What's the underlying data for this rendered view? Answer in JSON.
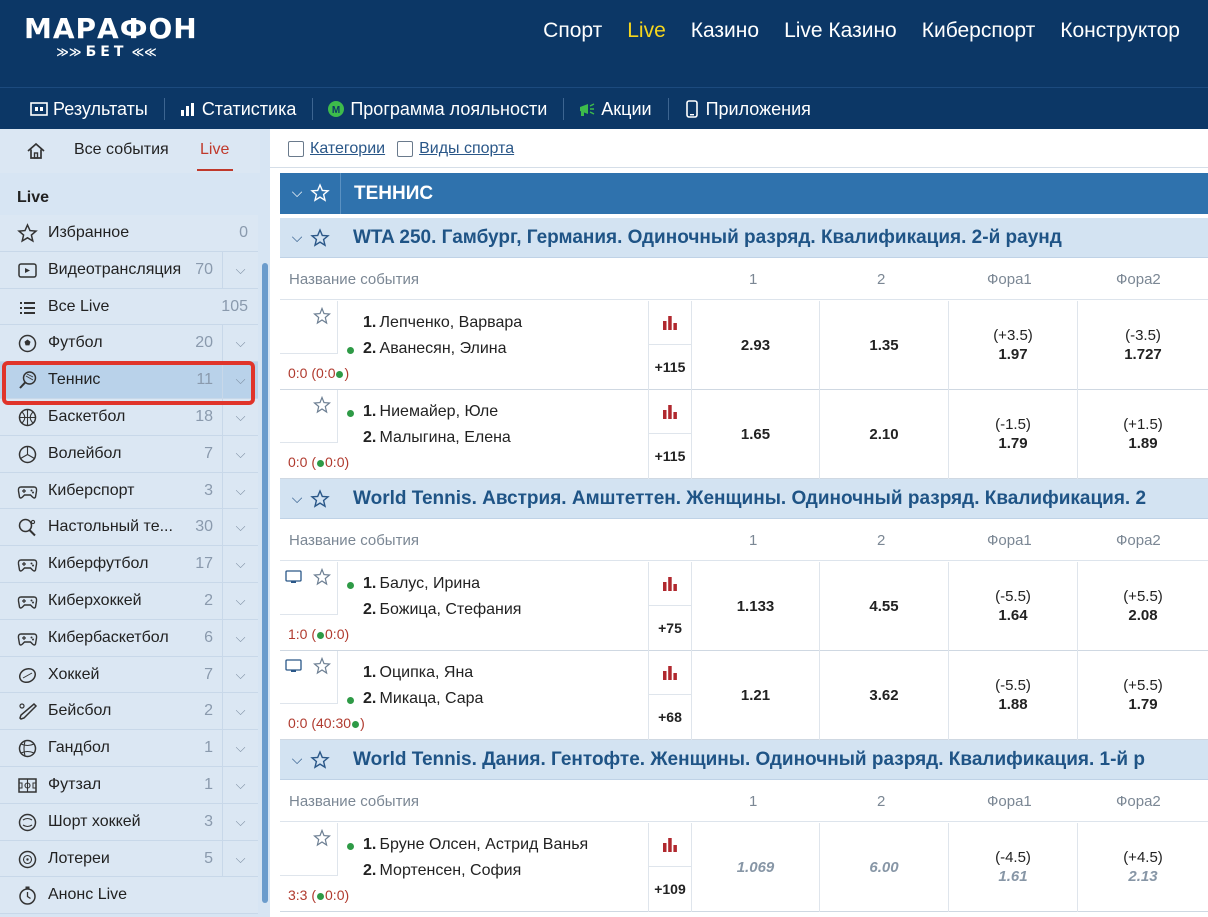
{
  "header": {
    "logo_main": "МАРАФОН",
    "logo_sub": "БЕТ",
    "nav": [
      {
        "label": "Спорт",
        "active": false
      },
      {
        "label": "Live",
        "active": true
      },
      {
        "label": "Казино",
        "active": false
      },
      {
        "label": "Live Казино",
        "active": false
      },
      {
        "label": "Киберспорт",
        "active": false
      },
      {
        "label": "Конструктор",
        "active": false
      }
    ]
  },
  "subnav": [
    {
      "label": "Результаты",
      "icon": "results-icon"
    },
    {
      "label": "Статистика",
      "icon": "statistics-icon"
    },
    {
      "label": "Программа лояльности",
      "icon": "loyalty-icon"
    },
    {
      "label": "Акции",
      "icon": "promo-icon"
    },
    {
      "label": "Приложения",
      "icon": "phone-icon"
    }
  ],
  "sidebar": {
    "tab_all": "Все события",
    "tab_live": "Live",
    "section_title": "Live",
    "items": [
      {
        "label": "Избранное",
        "count": "0",
        "icon": "star-icon",
        "chevron": false
      },
      {
        "label": "Видеотрансляция",
        "count": "70",
        "icon": "video-icon",
        "chevron": true
      },
      {
        "label": "Все Live",
        "count": "105",
        "icon": "list-icon",
        "chevron": false
      },
      {
        "label": "Футбол",
        "count": "20",
        "icon": "football-icon",
        "chevron": true
      },
      {
        "label": "Теннис",
        "count": "11",
        "icon": "tennis-icon",
        "chevron": true
      },
      {
        "label": "Баскетбол",
        "count": "18",
        "icon": "basketball-icon",
        "chevron": true
      },
      {
        "label": "Волейбол",
        "count": "7",
        "icon": "volleyball-icon",
        "chevron": true
      },
      {
        "label": "Киберспорт",
        "count": "3",
        "icon": "gamepad-icon",
        "chevron": true
      },
      {
        "label": "Настольный те...",
        "count": "30",
        "icon": "table-tennis-icon",
        "chevron": true
      },
      {
        "label": "Киберфутбол",
        "count": "17",
        "icon": "gamepad-icon",
        "chevron": true
      },
      {
        "label": "Киберхоккей",
        "count": "2",
        "icon": "gamepad-icon",
        "chevron": true
      },
      {
        "label": "Кибербаскетбол",
        "count": "6",
        "icon": "gamepad-icon",
        "chevron": true
      },
      {
        "label": "Хоккей",
        "count": "7",
        "icon": "hockey-icon",
        "chevron": true
      },
      {
        "label": "Бейсбол",
        "count": "2",
        "icon": "baseball-icon",
        "chevron": true
      },
      {
        "label": "Гандбол",
        "count": "1",
        "icon": "handball-icon",
        "chevron": true
      },
      {
        "label": "Футзал",
        "count": "1",
        "icon": "futsal-icon",
        "chevron": true
      },
      {
        "label": "Шорт хоккей",
        "count": "3",
        "icon": "short-hockey-icon",
        "chevron": true
      },
      {
        "label": "Лотереи",
        "count": "5",
        "icon": "lottery-icon",
        "chevron": true
      },
      {
        "label": "Анонс Live",
        "count": "",
        "icon": "clock-icon",
        "chevron": false
      }
    ]
  },
  "filters": {
    "categories": "Категории",
    "sports": "Виды спорта"
  },
  "sport": {
    "title": "ТЕННИС"
  },
  "columns": {
    "name": "Название события",
    "c1": "1",
    "c2": "2",
    "h1": "Фора1",
    "h2": "Фора2"
  },
  "leagues": [
    {
      "title": "WTA 250. Гамбург, Германия. Одиночный разряд. Квалификация. 2-й раунд",
      "events": [
        {
          "p1": "Лепченко, Варвара",
          "p2": "Аванесян, Элина",
          "serve": 2,
          "tv": false,
          "score_pre": "0:0 (0:0",
          "score_post": ")",
          "score_dot": "after",
          "more": "+115",
          "odd1": "2.93",
          "odd2": "1.35",
          "h1": "(+3.5)",
          "h1v": "1.97",
          "h2": "(-3.5)",
          "h2v": "1.727",
          "dim": false
        },
        {
          "p1": "Ниемайер, Юле",
          "p2": "Малыгина, Елена",
          "serve": 1,
          "tv": false,
          "score_pre": "0:0 (",
          "score_post": "0:0)",
          "score_dot": "before",
          "more": "+115",
          "odd1": "1.65",
          "odd2": "2.10",
          "h1": "(-1.5)",
          "h1v": "1.79",
          "h2": "(+1.5)",
          "h2v": "1.89",
          "dim": false
        }
      ]
    },
    {
      "title": "World Tennis. Австрия. Амштеттен. Женщины. Одиночный разряд. Квалификация. 2",
      "events": [
        {
          "p1": "Балус, Ирина",
          "p2": "Божица, Стефания",
          "serve": 1,
          "tv": true,
          "score_pre": "1:0 (",
          "score_post": "0:0)",
          "score_dot": "before",
          "more": "+75",
          "odd1": "1.133",
          "odd2": "4.55",
          "h1": "(-5.5)",
          "h1v": "1.64",
          "h2": "(+5.5)",
          "h2v": "2.08",
          "dim": false
        },
        {
          "p1": "Оципка, Яна",
          "p2": "Микаца, Сара",
          "serve": 2,
          "tv": true,
          "score_pre": "0:0 (40:30",
          "score_post": ")",
          "score_dot": "after",
          "more": "+68",
          "odd1": "1.21",
          "odd2": "3.62",
          "h1": "(-5.5)",
          "h1v": "1.88",
          "h2": "(+5.5)",
          "h2v": "1.79",
          "dim": false
        }
      ]
    },
    {
      "title": "World Tennis. Дания. Гентофте. Женщины. Одиночный разряд. Квалификация. 1-й р",
      "events": [
        {
          "p1": "Бруне Олсен, Астрид Ванья",
          "p2": "Мортенсен, София",
          "serve": 1,
          "tv": false,
          "score_pre": "3:3 (",
          "score_post": "0:0)",
          "score_dot": "before",
          "more": "+109",
          "odd1": "1.069",
          "odd2": "6.00",
          "h1": "(-4.5)",
          "h1v": "1.61",
          "h2": "(+4.5)",
          "h2v": "2.13",
          "dim": true
        }
      ]
    }
  ],
  "colors": {
    "header_bg": "#0c3766",
    "accent_yellow": "#f5d51d",
    "live_red": "#c0392b",
    "sport_bar": "#2f72ad",
    "league_bar": "#d3e3f2",
    "stat_red": "#b0282e",
    "serve_green": "#2e9a46"
  }
}
